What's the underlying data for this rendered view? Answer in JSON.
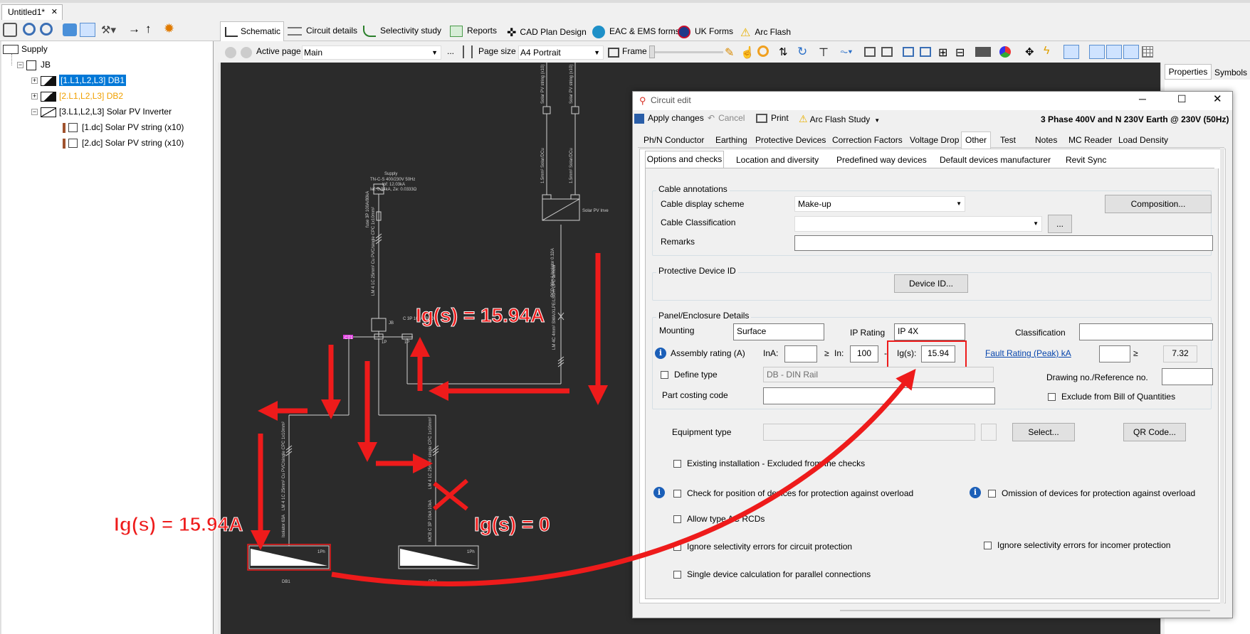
{
  "document_tab": {
    "title": "Untitled1*",
    "close": "✕"
  },
  "tree": {
    "supply": "Supply",
    "jb": "JB",
    "db1": "[1.L1,L2,L3] DB1",
    "db2": "[2.L1,L2,L3] DB2",
    "inverter": "[3.L1,L2,L3] Solar PV Inverter",
    "string1": "[1.dc] Solar PV string (x10)",
    "string2": "[2.dc] Solar PV string (x10)"
  },
  "main_tabs": [
    "Schematic",
    "Circuit details",
    "Selectivity study",
    "Reports",
    "CAD Plan Design",
    "EAC & EMS forms",
    "UK Forms",
    "Arc Flash"
  ],
  "page_bar": {
    "active_page_label": "Active page",
    "active_page_value": "Main",
    "page_size_label": "Page size",
    "page_size_value": "A4 Portrait",
    "frame_label": "Frame",
    "ellipsis": "..."
  },
  "right_panel_tabs": [
    "Properties",
    "Symbols"
  ],
  "schematic": {
    "supply_label": "Supply",
    "supply_line1": "TN-C-S 400/230V 50Hz",
    "supply_line2": "Ipf: 12.03kA",
    "supply_line3": "Ief: 6.94kA, Ze: 0.0333Ω",
    "fuse_label": "fuse 3P 100A/80kA",
    "cable_main": "LM 4 1C 25mm² Cu PVC/single CPC 1x10mm²",
    "cable_db1": "LM 4 1C 25mm² Cu PVC/single CPC 1x10mm²",
    "cable_db2": "LM 4 1C 25mm² single CPC 1x10mm²",
    "cable_inv": "LM 4C 4mm² SWA/XLPE/LSOH CPC armour",
    "mcb_label": "C 3P 10kA (Bi-Dir)",
    "rcd_label": "RCD 30mA Isolator 0.32A",
    "jb_label": "JB",
    "db1_label": "DB1",
    "db2_label": "DB2",
    "solar_label": "Solar PV Inve",
    "string1_vert": "Solar PV string (x10)",
    "string2_vert": "Solar PV string (x10)",
    "string_cable": "1.5mm² Solar/DCu",
    "isolator_label": "Isolator 63A",
    "mcb2_label": "MCB C 3P 10kA 10kA",
    "ct_tag": "CT1",
    "busbar_tag1": "1P",
    "busbar_tag2": "1P",
    "db_rating": "1Ph"
  },
  "annotations": {
    "ig_top": "Ig(s) = 15.94A",
    "ig_left": "Ig(s) = 15.94A",
    "ig_zero": "Ig(s) = 0"
  },
  "dialog": {
    "title": "Circuit edit",
    "apply": "Apply changes",
    "cancel": "Cancel",
    "print": "Print",
    "arc_flash": "Arc Flash Study",
    "system": "3 Phase 400V and N 230V Earth @ 230V (50Hz)",
    "tabs": [
      "Ph/N Conductor",
      "Earthing",
      "Protective Devices",
      "Correction Factors",
      "Voltage Drop",
      "Other",
      "Test",
      "Notes",
      "MC Reader",
      "Load Density"
    ],
    "subtabs": [
      "Options and checks",
      "Location and diversity",
      "Predefined way devices",
      "Default devices manufacturer",
      "Revit Sync"
    ],
    "cable_annotations": {
      "group": "Cable annotations",
      "display_label": "Cable display scheme",
      "display_value": "Make-up",
      "composition": "Composition...",
      "classification_label": "Cable Classification",
      "classification_value": "",
      "dots": "...",
      "remarks_label": "Remarks",
      "remarks_value": ""
    },
    "protective_id": {
      "group": "Protective Device ID",
      "button": "Device ID..."
    },
    "panel": {
      "group": "Panel/Enclosure Details",
      "mounting_label": "Mounting",
      "mounting_value": "Surface",
      "ip_label": "IP Rating",
      "ip_value": "IP 4X",
      "classification_label": "Classification",
      "classification_value": "",
      "assembly_label": "Assembly rating (A)",
      "ina_label": "InA:",
      "ina_value": "",
      "ge1": "≥",
      "in_label": "In:",
      "in_value": "100",
      "dash": "-",
      "igs_label": "Ig(s):",
      "igs_value": "15.94",
      "fault_label": "Fault Rating (Peak) kA",
      "fault_value": "",
      "ge2": "≥",
      "fault_min": "7.32",
      "define_type": "Define type",
      "type_value": "DB - DIN Rail",
      "drawing_label": "Drawing no./Reference no.",
      "drawing_value": "",
      "part_label": "Part costing code",
      "part_value": "",
      "exclude_boq": "Exclude from Bill of Quantities"
    },
    "equipment_label": "Equipment type",
    "select_btn": "Select...",
    "qr_btn": "QR Code...",
    "existing": "Existing installation - Excluded from the checks",
    "check_overload": "Check for position of devices for protection against overload",
    "omission_overload": "Omission of devices for protection against overload",
    "allow_ac": "Allow type AC RCDs",
    "ignore_circuit": "Ignore selectivity errors for circuit protection",
    "ignore_incomer": "Ignore selectivity errors for incomer protection",
    "single_device": "Single device calculation for parallel connections"
  },
  "colors": {
    "annotation_red": "#ee1b1b",
    "schematic_bg": "#2b2b2b",
    "selection_blue": "#0078d7",
    "db2_orange": "#f0a000"
  }
}
